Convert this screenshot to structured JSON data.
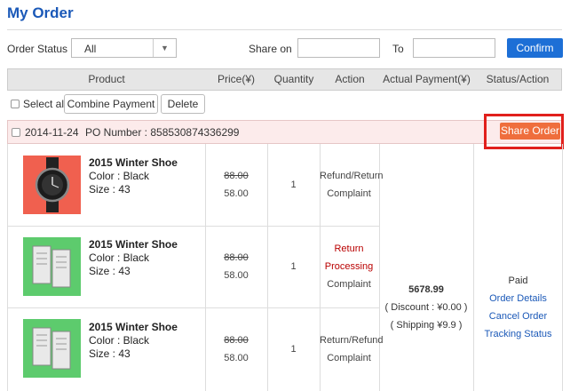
{
  "page": {
    "title": "My Order"
  },
  "filters": {
    "order_status_label": "Order Status",
    "order_status_value": "All",
    "share_on_label": "Share on",
    "to_label": "To",
    "confirm_label": "Confirm"
  },
  "table_header": {
    "product": "Product",
    "price": "Price(¥)",
    "quantity": "Quantity",
    "action": "Action",
    "actual_payment": "Actual Payment(¥)",
    "status_action": "Status/Action"
  },
  "toolbar": {
    "select_all": "Select all",
    "combine_payment": "Combine Payment",
    "delete": "Delete"
  },
  "order": {
    "date": "2014-11-24",
    "po_number": "PO Number : 858530874336299",
    "share_label": "Share Order",
    "items": [
      {
        "name": "2015 Winter Shoe",
        "color": "Color : Black",
        "size": "Size : 43",
        "price_old": "88.00",
        "price_new": "58.00",
        "quantity": "1",
        "actions": [
          "Refund/Return",
          "Complaint"
        ],
        "thumb_bg": "#f0604f",
        "thumb_kind": "watch-icon"
      },
      {
        "name": "2015 Winter Shoe",
        "color": "Color : Black",
        "size": "Size : 43",
        "price_old": "88.00",
        "price_new": "58.00",
        "quantity": "1",
        "actions": [
          "Return",
          "Processing",
          "Complaint"
        ],
        "thumb_bg": "#5dcb6d",
        "thumb_kind": "heater-icon"
      },
      {
        "name": "2015 Winter Shoe",
        "color": "Color : Black",
        "size": "Size : 43",
        "price_old": "88.00",
        "price_new": "58.00",
        "quantity": "1",
        "actions": [
          "Return/Refund",
          "Complaint"
        ],
        "thumb_bg": "#5dcb6d",
        "thumb_kind": "heater-icon"
      }
    ],
    "payment": {
      "total": "5678.99",
      "discount": "( Discount : ¥0.00 )",
      "shipping": "( Shipping ¥9.9 )"
    },
    "status": {
      "state": "Paid",
      "links": [
        "Order Details",
        "Cancel Order",
        "Tracking Status"
      ]
    }
  },
  "colors": {
    "accent_blue": "#1d6fd6",
    "title_blue": "#1b59b8",
    "share_orange": "#ef6e3d",
    "highlight_red": "#e1201c",
    "processing_red": "#b90000"
  }
}
